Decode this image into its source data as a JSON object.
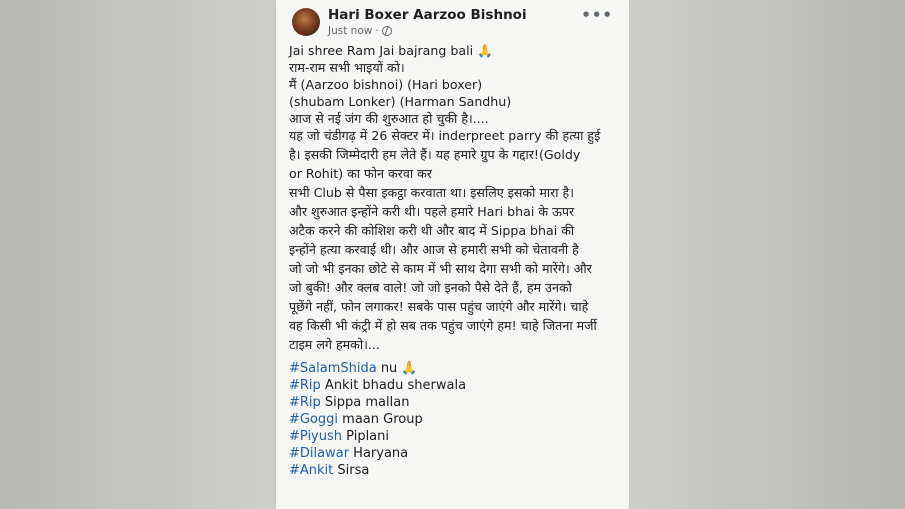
{
  "post": {
    "author": "Hari Boxer Aarzoo Bishnoi",
    "timestamp": "Just now",
    "separator": "·",
    "more_label": "•••",
    "lines": [
      "Jai shree Ram Jai bajrang bali 🙏",
      "राम-राम सभी भाइयों को।",
      "मैं (Aarzoo bishnoi) (Hari boxer)",
      "(shubam Lonker) (Harman Sandhu)",
      "आज से नई जंग की शुरुआत हो चुकी है।....",
      "यह जो चंडीगढ़ में 26 सेक्टर में। inderpreet parry की हत्या हुई",
      "है। इसकी जिम्मेदारी हम लेते हैं। यह हमारे ग्रुप के गद्दार!(Goldy",
      "or Rohit) का फोन करवा कर",
      "सभी Club से पैसा इकट्ठा करवाता था। इसलिए इसको मारा है।",
      "और शुरुआत इन्होंने करी थी। पहले हमारे Hari bhai  के ऊपर",
      "अटैक करने की कोशिश करी थी और बाद में Sippa bhai की",
      "इन्होंने हत्या करवाई थी। और आज से हमारी सभी को चेतावनी है",
      "जो जो भी इनका छोटे से काम में भी साथ देगा सभी को मारेंगे। और",
      "जो बुकी! और क्लब वाले! जो जो इनको पैसे देते हैं, हम उनको",
      "पूछेंगे नहीं, फोन लगाकर! सबके पास पहुंच जाएंगे और मारेंगे। चाहे",
      "वह किसी भी कंट्री में हो सब तक पहुंच जाएंगे हम! चाहे जितना मर्जी",
      "टाइम लगे हमको।..."
    ],
    "hashtags": [
      {
        "tag": "#SalamShida",
        "rest": " nu 🙏"
      },
      {
        "tag": "#Rip",
        "rest": " Ankit bhadu sherwala"
      },
      {
        "tag": "#Rip",
        "rest": " Sippa  mallan"
      },
      {
        "tag": "#Goggi",
        "rest": " maan Group"
      },
      {
        "tag": "#Piyush",
        "rest": " Piplani"
      },
      {
        "tag": "#Dilawar",
        "rest": " Haryana"
      },
      {
        "tag": "#Ankit",
        "rest": " Sirsa"
      }
    ]
  },
  "colors": {
    "hashtag": "#1f5ea8",
    "text": "#1c1e21",
    "meta": "#65676b",
    "card_bg": "#f6f6f4",
    "page_bg": "#bfc0be"
  },
  "icons": {
    "visibility": "globe-icon",
    "menu": "more-options-icon"
  }
}
